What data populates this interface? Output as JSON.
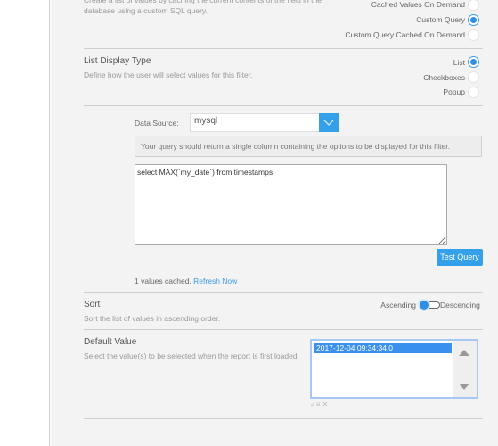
{
  "source_section": {
    "description": "Create a list of values by caching the current contents of the field in the database using a custom SQL query.",
    "options": [
      {
        "label": "Cached Values On Demand",
        "selected": false
      },
      {
        "label": "Custom Query",
        "selected": true
      },
      {
        "label": "Custom Query Cached On Demand",
        "selected": false
      }
    ]
  },
  "display_type": {
    "title": "List Display Type",
    "description": "Define how the user will select values for this filter.",
    "options": [
      {
        "label": "List",
        "selected": true
      },
      {
        "label": "Checkboxes",
        "selected": false
      },
      {
        "label": "Popup",
        "selected": false
      }
    ]
  },
  "query_panel": {
    "data_source_label": "Data Source:",
    "data_source_value": "mysql",
    "info_text": "Your query should return a single column containing the options to be displayed for this filter.",
    "query_text": "select MAX(`my_date`) from timestamps",
    "test_button": "Test Query",
    "cached_text": "1 values cached.",
    "refresh_link": "Refresh Now"
  },
  "sort": {
    "title": "Sort",
    "description": "Sort the list of values in ascending order.",
    "left_label": "Ascending",
    "right_label": "Descending",
    "value": "Ascending"
  },
  "default_value": {
    "title": "Default Value",
    "description": "Select the value(s) to be selected when the report is first loaded.",
    "items": [
      "2017-12-04 09:34:34.0"
    ],
    "selected": "2017-12-04 09:34:34.0"
  },
  "colors": {
    "accent": "#35a0ea",
    "panel_bg": "#f3f3f3"
  }
}
